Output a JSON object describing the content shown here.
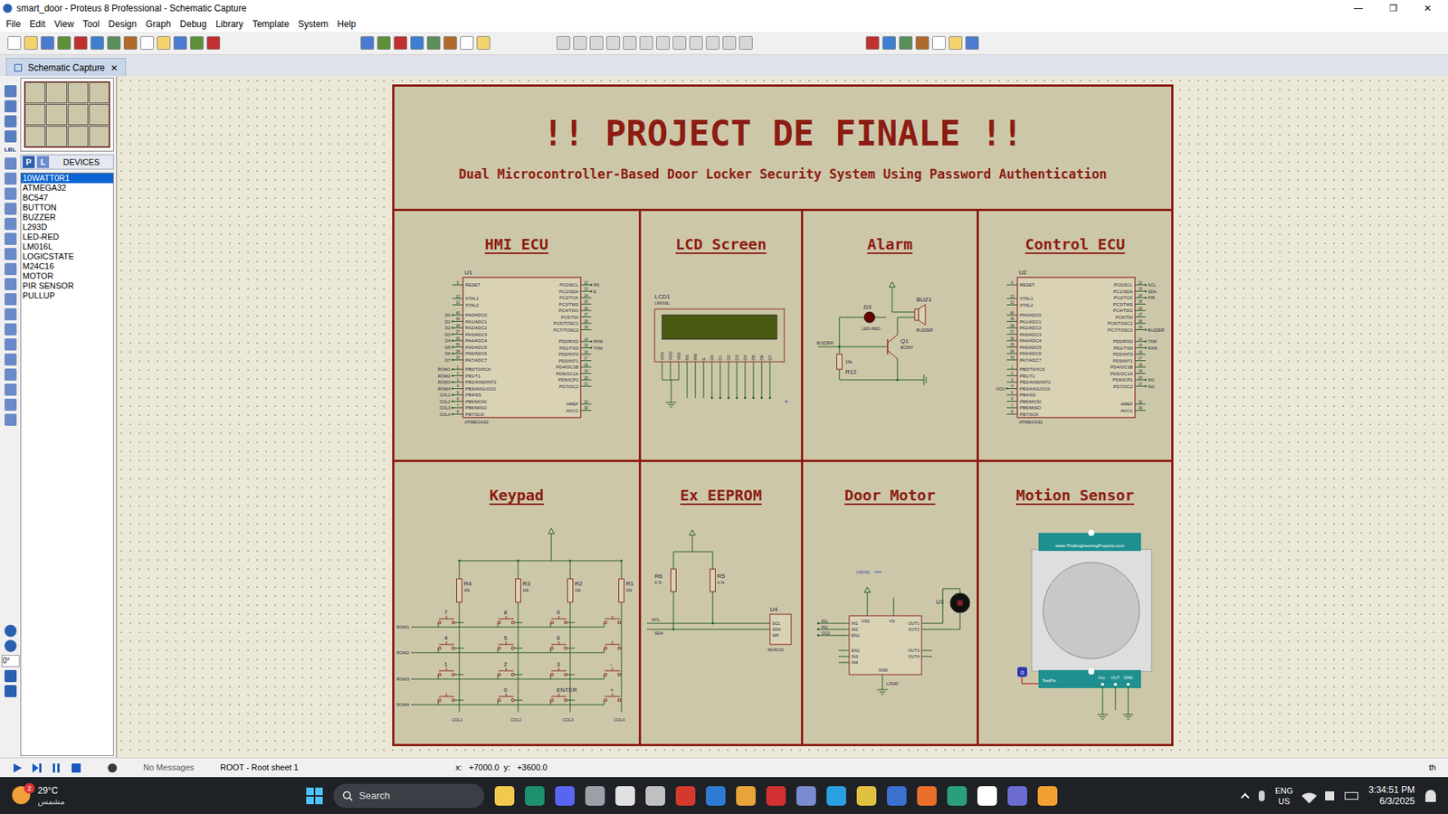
{
  "window": {
    "title": "smart_door - Proteus 8 Professional - Schematic Capture",
    "controls": [
      "—",
      "❐",
      "✕"
    ]
  },
  "menu": [
    "File",
    "Edit",
    "View",
    "Tool",
    "Design",
    "Graph",
    "Debug",
    "Library",
    "Template",
    "System",
    "Help"
  ],
  "tab": {
    "label": "Schematic Capture",
    "close": "×",
    "selected": true
  },
  "left_tools": {
    "label_tool": "LBL",
    "angle": "0°"
  },
  "devices": {
    "modes": [
      {
        "label": "P",
        "selected": true
      },
      {
        "label": "L",
        "selected": false
      }
    ],
    "header": "DEVICES",
    "items": [
      {
        "name": "10WATT0R1",
        "selected": true
      },
      {
        "name": "ATMEGA32",
        "selected": false
      },
      {
        "name": "BC547",
        "selected": false
      },
      {
        "name": "BUTTON",
        "selected": false
      },
      {
        "name": "BUZZER",
        "selected": false
      },
      {
        "name": "L293D",
        "selected": false
      },
      {
        "name": "LED-RED",
        "selected": false
      },
      {
        "name": "LM016L",
        "selected": false
      },
      {
        "name": "LOGICSTATE",
        "selected": false
      },
      {
        "name": "M24C16",
        "selected": false
      },
      {
        "name": "MOTOR",
        "selected": false
      },
      {
        "name": "PIR SENSOR",
        "selected": false
      },
      {
        "name": "PULLUP",
        "selected": false
      }
    ]
  },
  "sheet": {
    "title": "!! PROJECT DE FINALE !!",
    "subtitle": "Dual Microcontroller-Based Door Locker Security System Using Password Authentication"
  },
  "hmi": {
    "title": "HMI ECU",
    "chip": {
      "ref": "U1",
      "part": "ATMEGA32",
      "left": [
        {
          "name": "RESET",
          "num": "9",
          "net": ""
        },
        {
          "name": "XTAL1",
          "num": "13",
          "net": ""
        },
        {
          "name": "XTAL2",
          "num": "12",
          "net": ""
        },
        {
          "name": "PA0/ADC0",
          "num": "40",
          "net": "D0"
        },
        {
          "name": "PA1/ADC1",
          "num": "39",
          "net": "D1"
        },
        {
          "name": "PA2/ADC2",
          "num": "38",
          "net": "D2"
        },
        {
          "name": "PA3/ADC3",
          "num": "37",
          "net": "D3"
        },
        {
          "name": "PA4/ADC4",
          "num": "36",
          "net": "D4"
        },
        {
          "name": "PA5/ADC5",
          "num": "35",
          "net": "D5"
        },
        {
          "name": "PA6/ADC6",
          "num": "34",
          "net": "D6"
        },
        {
          "name": "PA7/ADC7",
          "num": "33",
          "net": "D7"
        },
        {
          "name": "PB0/T0/XCK",
          "num": "1",
          "net": "ROW1"
        },
        {
          "name": "PB1/T1",
          "num": "2",
          "net": "ROW2"
        },
        {
          "name": "PB2/AIN0/INT2",
          "num": "3",
          "net": "ROW3"
        },
        {
          "name": "PB3/AIN1/OC0",
          "num": "4",
          "net": "ROW4"
        },
        {
          "name": "PB4/SS",
          "num": "5",
          "net": "COL1"
        },
        {
          "name": "PB5/MOSI",
          "num": "6",
          "net": "COL2"
        },
        {
          "name": "PB6/MISO",
          "num": "7",
          "net": "COL3"
        },
        {
          "name": "PB7/SCK",
          "num": "8",
          "net": "COL4"
        }
      ],
      "right": [
        {
          "name": "PC0/SCL",
          "num": "22",
          "net": "RS"
        },
        {
          "name": "PC1/SDA",
          "num": "23",
          "net": "E"
        },
        {
          "name": "PC2/TCK",
          "num": "24",
          "net": ""
        },
        {
          "name": "PC3/TMS",
          "num": "25",
          "net": ""
        },
        {
          "name": "PC4/TDO",
          "num": "26",
          "net": ""
        },
        {
          "name": "PC5/TDI",
          "num": "27",
          "net": ""
        },
        {
          "name": "PC6/TOSC1",
          "num": "28",
          "net": ""
        },
        {
          "name": "PC7/TOSC2",
          "num": "29",
          "net": ""
        },
        {
          "name": "PD0/RXD",
          "num": "14",
          "net": "RXM"
        },
        {
          "name": "PD1/TXD",
          "num": "15",
          "net": "TXM"
        },
        {
          "name": "PD2/INT0",
          "num": "16",
          "net": ""
        },
        {
          "name": "PD3/INT1",
          "num": "17",
          "net": ""
        },
        {
          "name": "PD4/OC1B",
          "num": "18",
          "net": ""
        },
        {
          "name": "PD5/OC1A",
          "num": "19",
          "net": ""
        },
        {
          "name": "PD6/ICP1",
          "num": "20",
          "net": ""
        },
        {
          "name": "PD7/OC2",
          "num": "21",
          "net": ""
        },
        {
          "name": "AREF",
          "num": "32",
          "net": ""
        },
        {
          "name": "AVCC",
          "num": "30",
          "net": ""
        }
      ]
    }
  },
  "lcd": {
    "title": "LCD Screen",
    "ref": "LCD1",
    "part": "LM016L",
    "pins": [
      "VSS",
      "VDD",
      "VEE",
      "RS",
      "RW",
      "E",
      "D0",
      "D1",
      "D2",
      "D3",
      "D4",
      "D5",
      "D6",
      "D7"
    ]
  },
  "alarm": {
    "title": "Alarm",
    "led": {
      "ref": "D3",
      "part": "LED-RED"
    },
    "buzzer": {
      "ref": "BUZ1",
      "part": "BUZZER"
    },
    "transistor": {
      "ref": "Q1",
      "part": "BC547"
    },
    "resistor": {
      "ref": "R12",
      "value": "10k"
    },
    "net": "BUZZER"
  },
  "control": {
    "title": "Control ECU",
    "chip": {
      "ref": "U2",
      "part": "ATMEGA32",
      "left": [
        {
          "name": "RESET",
          "num": "9",
          "net": ""
        },
        {
          "name": "XTAL1",
          "num": "13",
          "net": ""
        },
        {
          "name": "XTAL2",
          "num": "12",
          "net": ""
        },
        {
          "name": "PA0/ADC0",
          "num": "40",
          "net": ""
        },
        {
          "name": "PA1/ADC1",
          "num": "39",
          "net": ""
        },
        {
          "name": "PA2/ADC2",
          "num": "38",
          "net": ""
        },
        {
          "name": "PA3/ADC3",
          "num": "37",
          "net": ""
        },
        {
          "name": "PA4/ADC4",
          "num": "36",
          "net": ""
        },
        {
          "name": "PA5/ADC5",
          "num": "35",
          "net": ""
        },
        {
          "name": "PA6/ADC6",
          "num": "34",
          "net": ""
        },
        {
          "name": "PA7/ADC7",
          "num": "33",
          "net": ""
        },
        {
          "name": "PB0/T0/XCK",
          "num": "1",
          "net": ""
        },
        {
          "name": "PB1/T1",
          "num": "2",
          "net": ""
        },
        {
          "name": "PB2/AIN0/INT2",
          "num": "3",
          "net": ""
        },
        {
          "name": "PB3/AIN1/OC0",
          "num": "4",
          "net": "OC0"
        },
        {
          "name": "PB4/SS",
          "num": "5",
          "net": ""
        },
        {
          "name": "PB5/MOSI",
          "num": "6",
          "net": ""
        },
        {
          "name": "PB6/MISO",
          "num": "7",
          "net": ""
        },
        {
          "name": "PB7/SCK",
          "num": "8",
          "net": ""
        }
      ],
      "right": [
        {
          "name": "PC0/SCL",
          "num": "22",
          "net": "SCL"
        },
        {
          "name": "PC1/SDA",
          "num": "23",
          "net": "SDA"
        },
        {
          "name": "PC2/TCK",
          "num": "24",
          "net": "PIR"
        },
        {
          "name": "PC3/TMS",
          "num": "25",
          "net": ""
        },
        {
          "name": "PC4/TDO",
          "num": "26",
          "net": ""
        },
        {
          "name": "PC5/TDI",
          "num": "27",
          "net": ""
        },
        {
          "name": "PC6/TOSC1",
          "num": "28",
          "net": ""
        },
        {
          "name": "PC7/TOSC2",
          "num": "29",
          "net": "BUZZER"
        },
        {
          "name": "PD0/RXD",
          "num": "14",
          "net": "TXM"
        },
        {
          "name": "PD1/TXD",
          "num": "15",
          "net": "RXM"
        },
        {
          "name": "PD2/INT0",
          "num": "16",
          "net": ""
        },
        {
          "name": "PD3/INT1",
          "num": "17",
          "net": ""
        },
        {
          "name": "PD4/OC1B",
          "num": "18",
          "net": ""
        },
        {
          "name": "PD5/OC1A",
          "num": "19",
          "net": ""
        },
        {
          "name": "PD6/ICP1",
          "num": "20",
          "net": "IN1"
        },
        {
          "name": "PD7/OC2",
          "num": "21",
          "net": "IN2"
        },
        {
          "name": "AREF",
          "num": "32",
          "net": ""
        },
        {
          "name": "AVCC",
          "num": "30",
          "net": ""
        }
      ]
    }
  },
  "keypad": {
    "title": "Keypad",
    "resistors": [
      {
        "ref": "R4",
        "value": "10k"
      },
      {
        "ref": "R3",
        "value": "10k"
      },
      {
        "ref": "R2",
        "value": "10k"
      },
      {
        "ref": "R1",
        "value": "10k"
      }
    ],
    "rows": [
      {
        "net": "ROW1",
        "keys": [
          "7",
          "8",
          "9",
          ""
        ]
      },
      {
        "net": "ROW2",
        "keys": [
          "4",
          "5",
          "6",
          ""
        ]
      },
      {
        "net": "ROW3",
        "keys": [
          "1",
          "2",
          "3",
          "-"
        ]
      },
      {
        "net": "ROW4",
        "keys": [
          "",
          "0",
          "ENTER",
          "+"
        ]
      }
    ],
    "columns": [
      "COL1",
      "COL2",
      "COL3",
      "COL4"
    ]
  },
  "eeprom": {
    "title": "Ex EEPROM",
    "resistors": [
      {
        "ref": "R6",
        "value": "4.7k"
      },
      {
        "ref": "R5",
        "value": "4.7k"
      }
    ],
    "chip": {
      "ref": "U4",
      "part": "M24C16",
      "pins": [
        "SCL",
        "SDA",
        "WP"
      ]
    },
    "nets": [
      "SCL",
      "SDA"
    ]
  },
  "motor": {
    "title": "Door Motor",
    "chip": {
      "ref": "U3",
      "part": "L293D",
      "left": [
        "IN1",
        "IN2",
        "EN1",
        "EN2",
        "IN3",
        "IN4"
      ],
      "top": [
        "VSS",
        "VS"
      ],
      "bottom": "GND",
      "right": [
        "OUT1",
        "OUT2",
        "OUT3",
        "OUT4"
      ]
    },
    "nets": [
      "IN1",
      "IN2",
      "OC0"
    ],
    "supply": "U3(VS)"
  },
  "sensor": {
    "title": "Motion Sensor",
    "site": "www.TheEngineeringProjects.com",
    "pins": [
      "Vcc",
      "OUT",
      "GND"
    ],
    "test": "TestPin",
    "logic": "0"
  },
  "status": {
    "messages": "No Messages",
    "sheet": "ROOT - Root sheet 1",
    "coords": "x:   +7000.0  y:   +3600.0",
    "right": "th"
  },
  "taskbar": {
    "temp": "29°C",
    "condition": "مشمس",
    "badge": "2",
    "search": "Search",
    "lang": "ENG",
    "region": "US",
    "time": "3:34:51 PM",
    "date": "6/3/2025"
  }
}
